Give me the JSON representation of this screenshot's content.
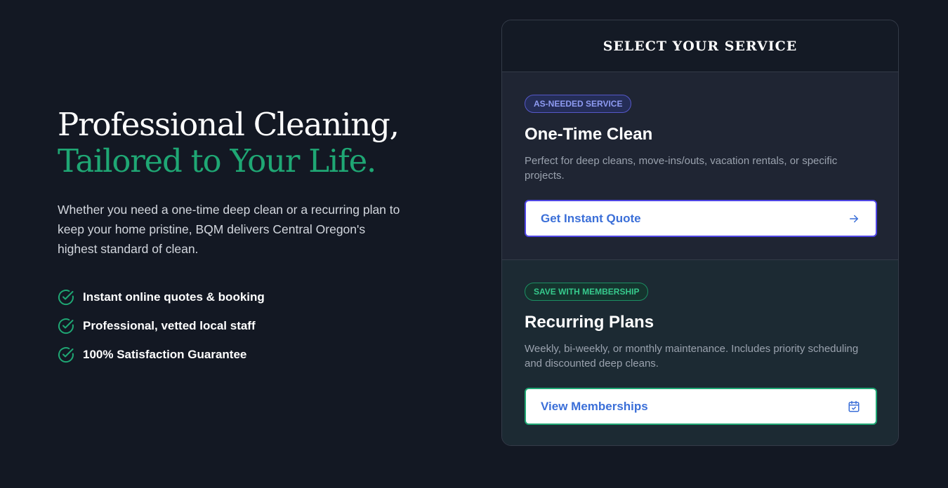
{
  "hero": {
    "title_line1": "Professional Cleaning,",
    "title_line2": "Tailored to Your Life.",
    "description": "Whether you need a one-time deep clean or a recurring plan to keep your home pristine, BQM delivers Central Oregon's highest standard of clean.",
    "features": [
      {
        "label": "Instant online quotes & booking",
        "icon": "check-circle-icon"
      },
      {
        "label": "Professional, vetted local staff",
        "icon": "check-circle-icon"
      },
      {
        "label": "100% Satisfaction Guarantee",
        "icon": "check-circle-icon"
      }
    ]
  },
  "service_card": {
    "title": "SELECT YOUR SERVICE",
    "options": [
      {
        "badge": "AS-NEEDED SERVICE",
        "heading": "One-Time Clean",
        "description": "Perfect for deep cleans, move-ins/outs, vacation rentals, or specific projects.",
        "cta_label": "Get Instant Quote",
        "cta_icon": "arrow-right-icon"
      },
      {
        "badge": "SAVE WITH MEMBERSHIP",
        "heading": "Recurring Plans",
        "description": "Weekly, bi-weekly, or monthly maintenance. Includes priority scheduling and discounted deep cleans.",
        "cta_label": "View Memberships",
        "cta_icon": "calendar-check-icon"
      }
    ]
  },
  "colors": {
    "background": "#131823",
    "accent_green": "#1fa774",
    "accent_indigo": "#4f46e5",
    "link_blue": "#3b6fd8"
  }
}
